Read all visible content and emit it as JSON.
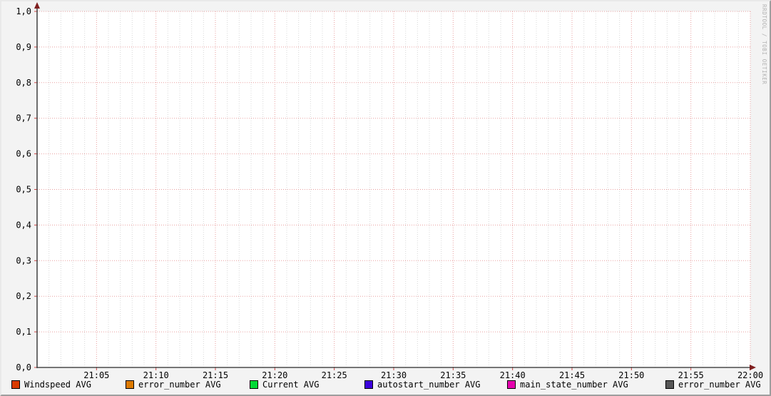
{
  "watermark": "RRDTOOL / TOBI OETIKER",
  "colors": {
    "background": "#f3f3f3",
    "canvas": "#ffffff",
    "major_grid": "#e9a0a0",
    "minor_grid": "#d8d8d8",
    "axis": "#4a4a4a",
    "arrow": "#7f1f1f",
    "tick": "#cc4444",
    "text": "#000000",
    "watermark_text": "#b2b2b2"
  },
  "chart_data": {
    "type": "line",
    "title": "",
    "xlabel": "",
    "ylabel": "",
    "plot_empty": true,
    "grid": true,
    "legend_position": "bottom",
    "x_axis": {
      "start": "21:00",
      "end": "22:00",
      "major_tick_minutes": 5,
      "minor_tick_minutes": 1,
      "tick_labels": [
        "21:05",
        "21:10",
        "21:15",
        "21:20",
        "21:25",
        "21:30",
        "21:35",
        "21:40",
        "21:45",
        "21:50",
        "21:55",
        "22:00"
      ]
    },
    "y_axis": {
      "min": 0.0,
      "max": 1.0,
      "major_step": 0.1,
      "tick_labels": [
        "0,0",
        "0,1",
        "0,2",
        "0,3",
        "0,4",
        "0,5",
        "0,6",
        "0,7",
        "0,8",
        "0,9",
        "1,0"
      ]
    },
    "series": [
      {
        "name": "Windspeed AVG",
        "color": "#d93b00",
        "values": []
      },
      {
        "name": "error_number AVG",
        "color": "#dd7a00",
        "values": []
      },
      {
        "name": "Current AVG",
        "color": "#00d936",
        "values": []
      },
      {
        "name": "autostart_number AVG",
        "color": "#3c00dc",
        "values": []
      },
      {
        "name": "main_state_number AVG",
        "color": "#e500ae",
        "values": []
      },
      {
        "name": "error_number AVG",
        "color": "#575757",
        "values": []
      }
    ]
  },
  "legend": {
    "items": [
      {
        "label": "Windspeed AVG",
        "color": "#d93b00"
      },
      {
        "label": "error_number AVG",
        "color": "#dd7a00"
      },
      {
        "label": "Current AVG",
        "color": "#00d936"
      },
      {
        "label": "autostart_number AVG",
        "color": "#3c00dc"
      },
      {
        "label": "main_state_number AVG",
        "color": "#e500ae"
      },
      {
        "label": "error_number AVG",
        "color": "#575757"
      }
    ]
  }
}
